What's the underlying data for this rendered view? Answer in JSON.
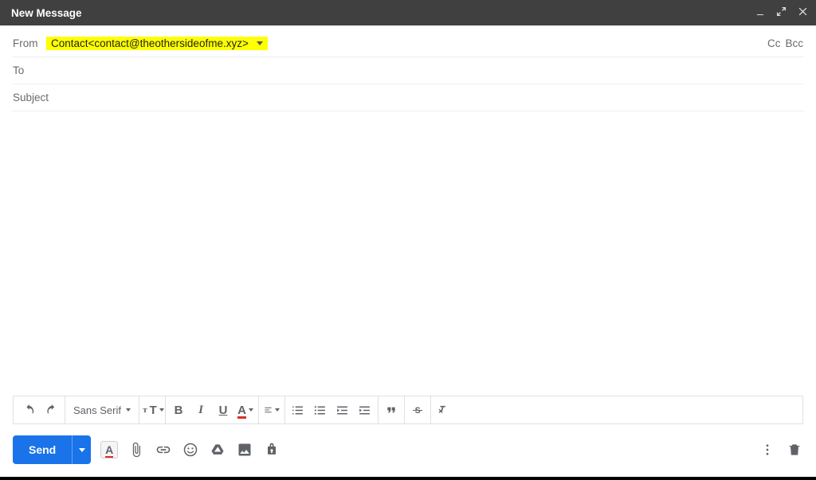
{
  "window": {
    "title": "New Message"
  },
  "fields": {
    "from_label": "From",
    "from_value": "Contact<contact@theothersideofme.xyz>",
    "to_label": "To",
    "subject_placeholder": "Subject",
    "cc_label": "Cc",
    "bcc_label": "Bcc"
  },
  "format_toolbar": {
    "font_family": "Sans Serif"
  },
  "actions": {
    "send_label": "Send"
  }
}
